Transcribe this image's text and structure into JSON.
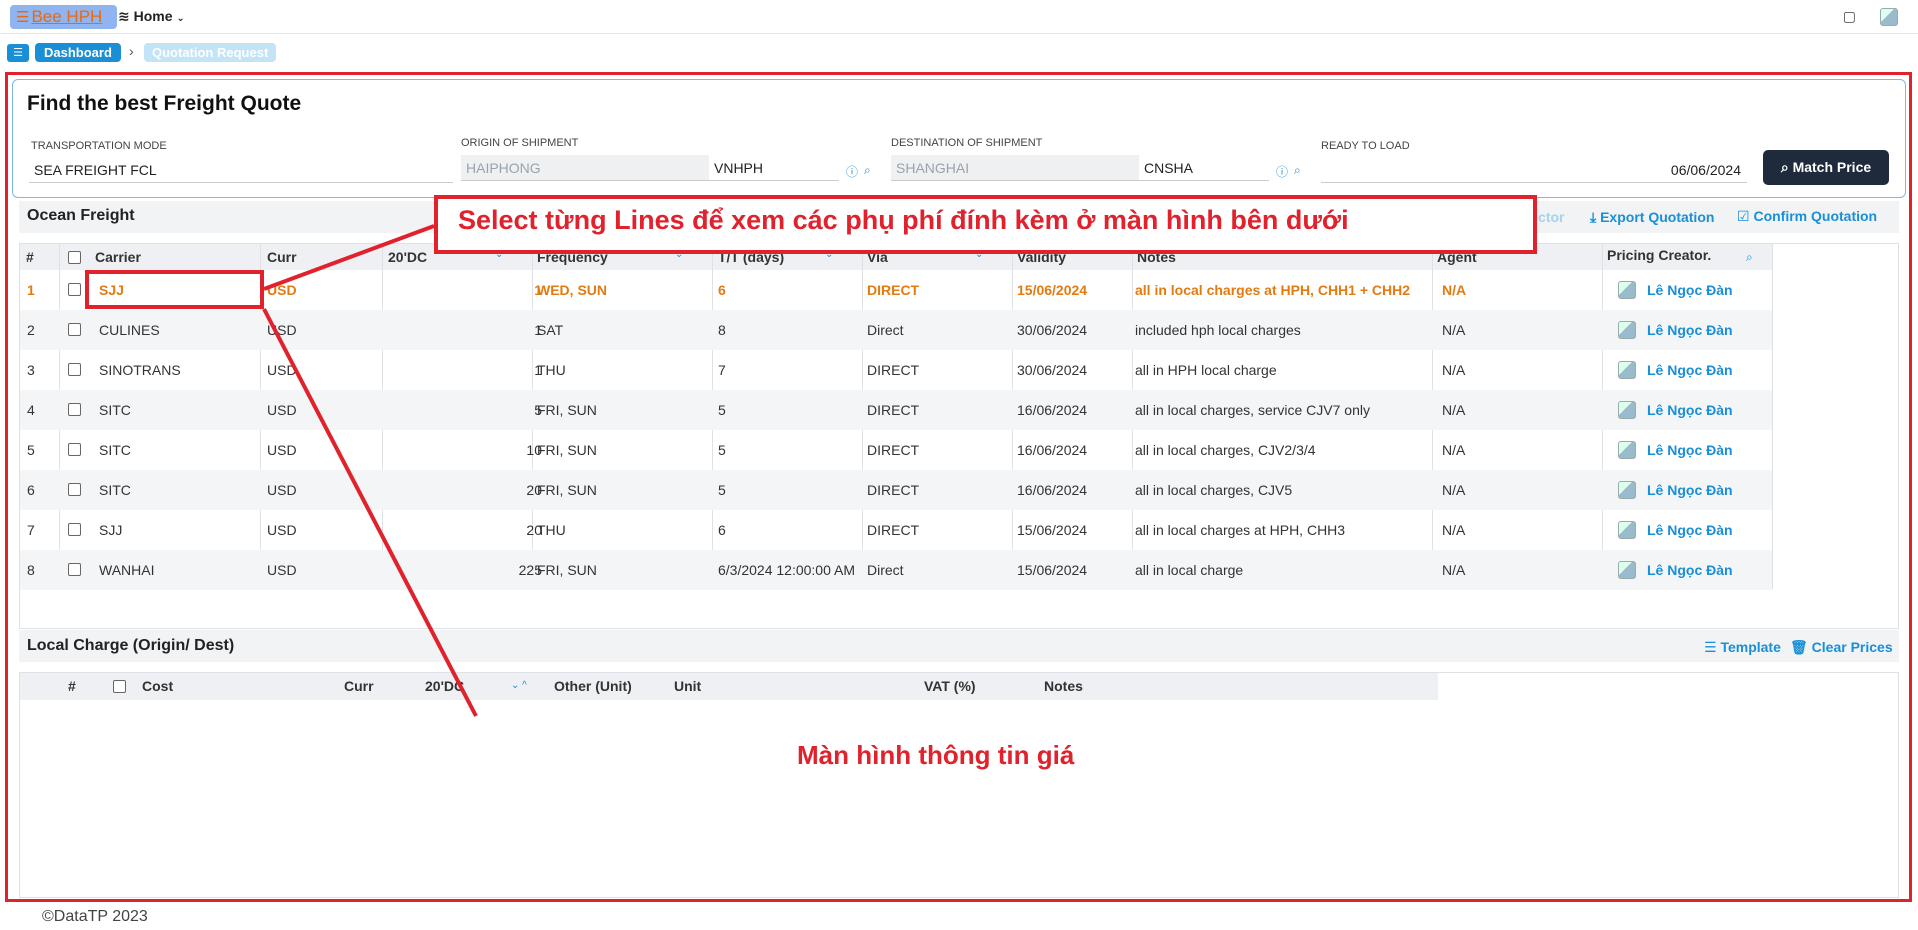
{
  "topbar": {
    "brand": "Bee HPH",
    "home": "Home",
    "brand_menu_icon": "menu-icon",
    "home_icon": "layers-icon",
    "chat_icon": "chat-icon",
    "avatar_icon": "avatar-icon"
  },
  "breadcrumb": {
    "dashboard": "Dashboard",
    "separator": "›",
    "current": "Quotation Request"
  },
  "quote_form": {
    "title": "Find the best Freight Quote",
    "transport_label": "TRANSPORTATION MODE",
    "transport_value": "SEA FREIGHT FCL",
    "origin_label": "ORIGIN OF SHIPMENT",
    "origin_value": "HAIPHONG",
    "origin_code": "VNHPH",
    "dest_label": "DESTINATION OF SHIPMENT",
    "dest_value": "SHANGHAI",
    "dest_code": "CNSHA",
    "ready_label": "READY TO LOAD",
    "ready_value": "06/06/2024",
    "match_button": "Match Price"
  },
  "ocean_freight": {
    "title": "Ocean Freight",
    "actions": {
      "container_selector": "Container Selector",
      "export_quotation": "Export Quotation",
      "confirm_quotation": "Confirm Quotation"
    },
    "columns": [
      "#",
      "Carrier",
      "Curr",
      "20'DC",
      "Frequency",
      "T/T (days)",
      "Via",
      "Validity",
      "Notes",
      "Agent",
      "Pricing Creator."
    ],
    "rows": [
      {
        "no": "1",
        "carrier": "SJJ",
        "curr": "USD",
        "dc20": "1",
        "freq": "WED, SUN",
        "tt": "6",
        "via": "DIRECT",
        "validity": "15/06/2024",
        "notes": "all in local charges at HPH, CHH1 + CHH2",
        "agent": "N/A",
        "creator": "Lê Ngọc Đàn"
      },
      {
        "no": "2",
        "carrier": "CULINES",
        "curr": "USD",
        "dc20": "1",
        "freq": "SAT",
        "tt": "8",
        "via": "Direct",
        "validity": "30/06/2024",
        "notes": "included hph local charges",
        "agent": "N/A",
        "creator": "Lê Ngọc Đàn"
      },
      {
        "no": "3",
        "carrier": "SINOTRANS",
        "curr": "USD",
        "dc20": "1",
        "freq": "THU",
        "tt": "7",
        "via": "DIRECT",
        "validity": "30/06/2024",
        "notes": "all in HPH local charge",
        "agent": "N/A",
        "creator": "Lê Ngọc Đàn"
      },
      {
        "no": "4",
        "carrier": "SITC",
        "curr": "USD",
        "dc20": "5",
        "freq": "FRI, SUN",
        "tt": "5",
        "via": "DIRECT",
        "validity": "16/06/2024",
        "notes": "all in local charges, service CJV7 only",
        "agent": "N/A",
        "creator": "Lê Ngọc Đàn"
      },
      {
        "no": "5",
        "carrier": "SITC",
        "curr": "USD",
        "dc20": "10",
        "freq": "FRI, SUN",
        "tt": "5",
        "via": "DIRECT",
        "validity": "16/06/2024",
        "notes": "all in local charges, CJV2/3/4",
        "agent": "N/A",
        "creator": "Lê Ngọc Đàn"
      },
      {
        "no": "6",
        "carrier": "SITC",
        "curr": "USD",
        "dc20": "20",
        "freq": "FRI, SUN",
        "tt": "5",
        "via": "DIRECT",
        "validity": "16/06/2024",
        "notes": "all in local charges, CJV5",
        "agent": "N/A",
        "creator": "Lê Ngọc Đàn"
      },
      {
        "no": "7",
        "carrier": "SJJ",
        "curr": "USD",
        "dc20": "20",
        "freq": "THU",
        "tt": "6",
        "via": "DIRECT",
        "validity": "15/06/2024",
        "notes": "all in local charges at HPH, CHH3",
        "agent": "N/A",
        "creator": "Lê Ngọc Đàn"
      },
      {
        "no": "8",
        "carrier": "WANHAI",
        "curr": "USD",
        "dc20": "225",
        "freq": "FRI, SUN",
        "tt": "6/3/2024 12:00:00 AM",
        "via": "Direct",
        "validity": "15/06/2024",
        "notes": "all in local charge",
        "agent": "N/A",
        "creator": "Lê Ngọc Đàn"
      }
    ]
  },
  "local_charge": {
    "title": "Local Charge (Origin/ Dest)",
    "template": "Template",
    "clear_prices": "Clear Prices",
    "columns": [
      "#",
      "Cost",
      "Curr",
      "20'DC",
      "Other (Unit)",
      "Unit",
      "VAT (%)",
      "Notes"
    ]
  },
  "annotations": {
    "select_lines": "Select từng Lines để xem các phụ phí đính kèm ở màn hình bên dưới",
    "price_screen": "Màn hình thông tin giá",
    "color": "#e0222d"
  },
  "footer": "©DataTP 2023",
  "colors": {
    "accent": "#1a8fd6",
    "highlight_row": "#e37b11",
    "match_button": "#1f2a3c"
  }
}
